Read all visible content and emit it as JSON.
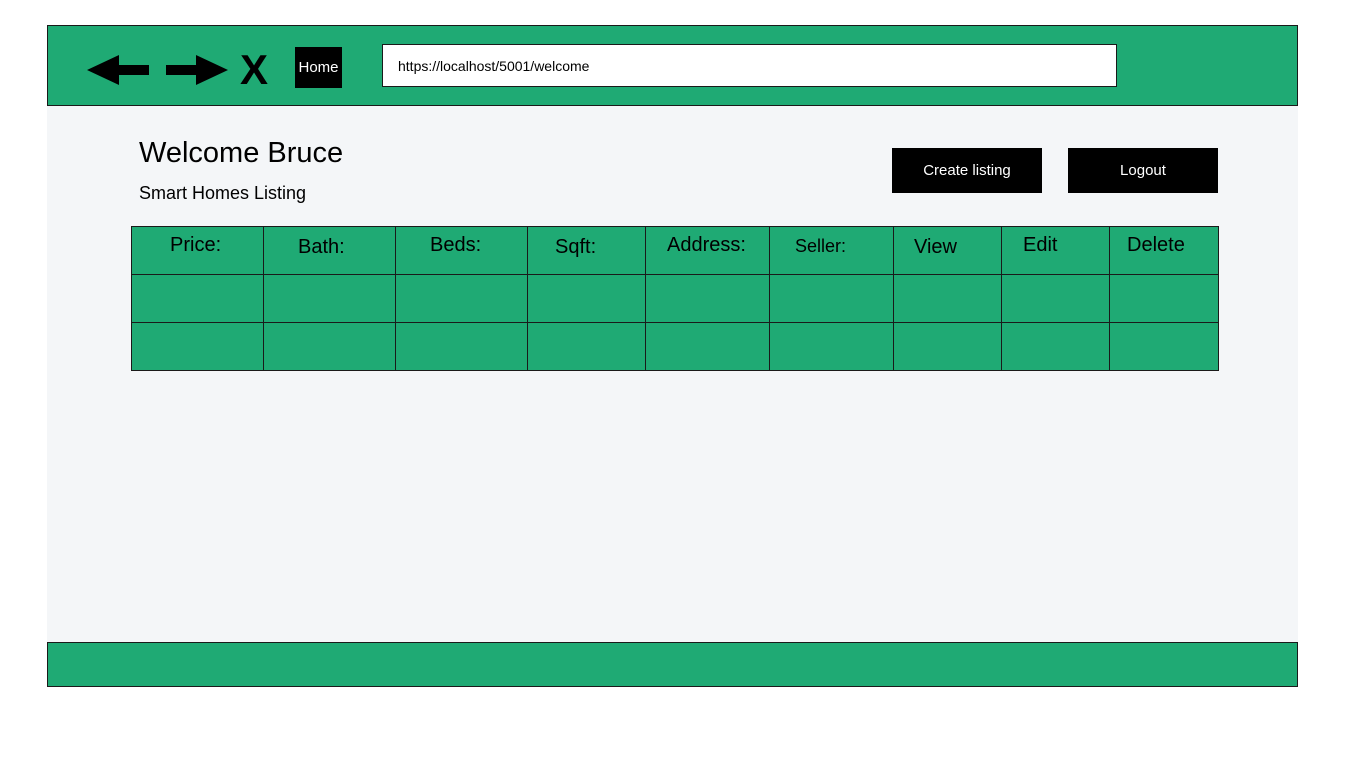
{
  "browser": {
    "home_label": "Home",
    "close_glyph": "X",
    "url": "https://localhost/5001/welcome"
  },
  "page": {
    "title": "Welcome Bruce",
    "subtitle": "Smart Homes Listing",
    "create_label": "Create listing",
    "logout_label": "Logout"
  },
  "table": {
    "headers": [
      "Price:",
      "Bath:",
      "Beds:",
      "Sqft:",
      "Address:",
      "Seller:",
      "View",
      "Edit",
      "Delete"
    ],
    "rows": [
      [
        "",
        "",
        "",
        "",
        "",
        "",
        "",
        "",
        ""
      ],
      [
        "",
        "",
        "",
        "",
        "",
        "",
        "",
        "",
        ""
      ]
    ]
  },
  "colors": {
    "accent": "#1faa74",
    "background": "#f4f6f8",
    "button": "#000000"
  },
  "icons": {
    "back": "back-arrow-icon",
    "forward": "forward-arrow-icon",
    "close": "close-icon"
  }
}
